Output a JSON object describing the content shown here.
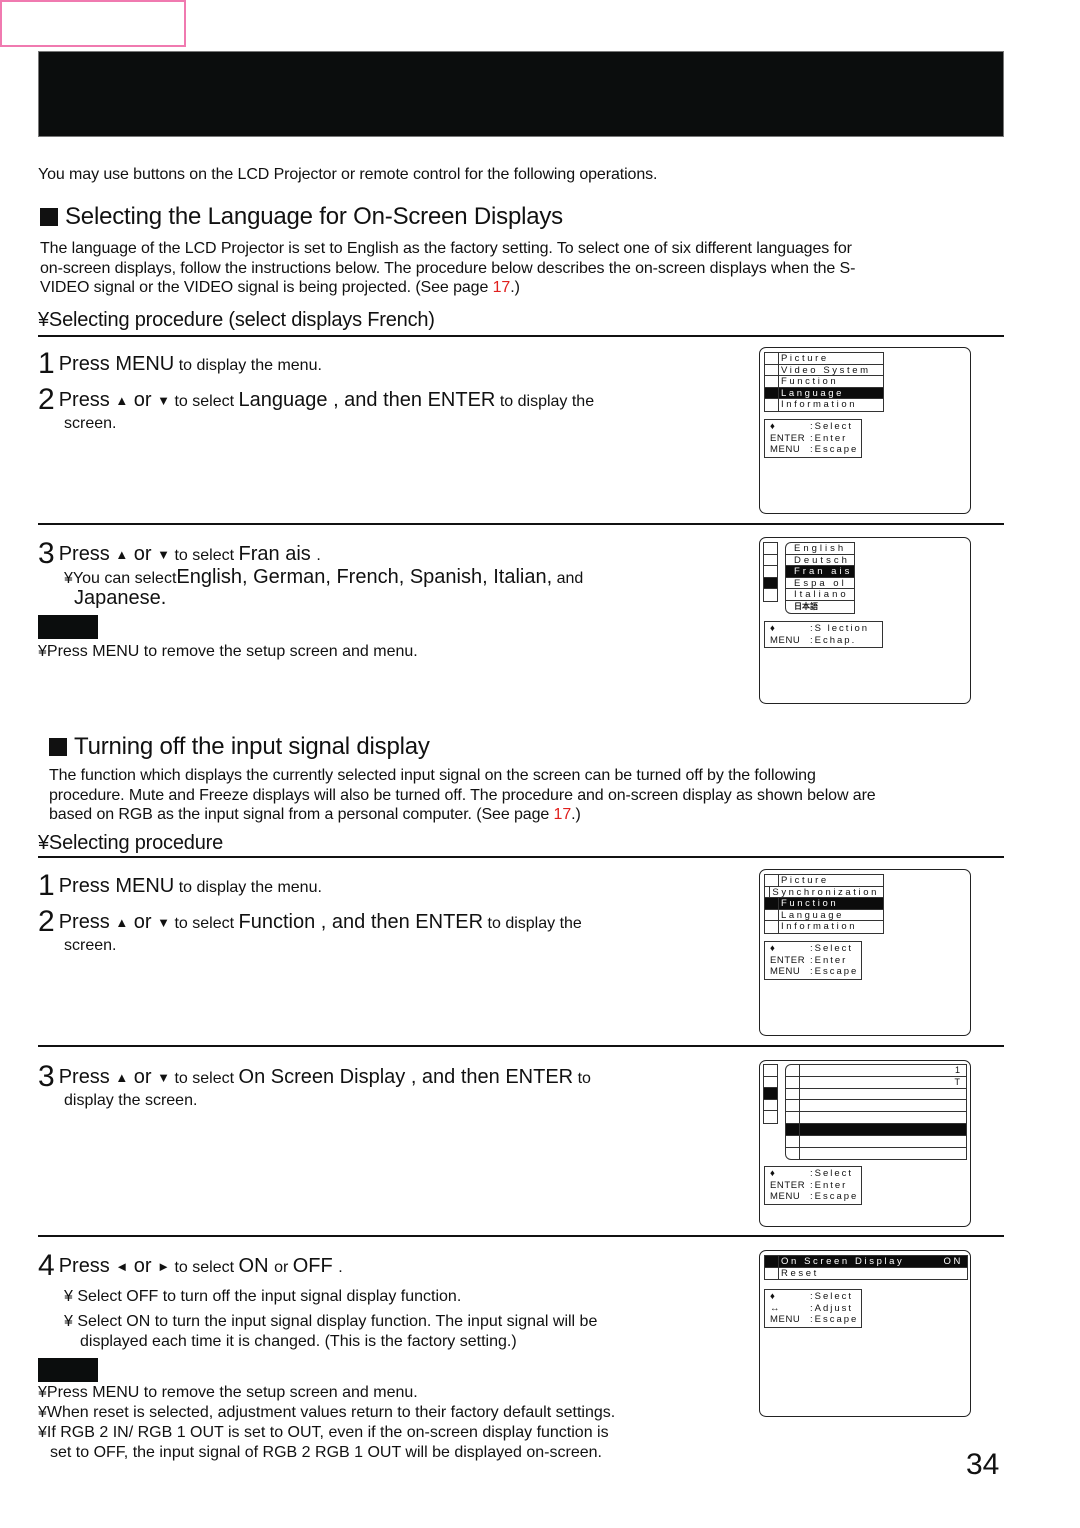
{
  "intro": "You may use buttons on the LCD Projector or remote control for the following operations.",
  "section1": {
    "heading": "Selecting the Language for On-Screen Displays",
    "para_lines": [
      "The language of the LCD Projector is set to English as the factory setting. To select one of six different languages for",
      "on-screen displays, follow the instructions below. The procedure below describes the on-screen displays when the S-",
      "VIDEO signal or the VIDEO signal is being projected. (See page "
    ],
    "para_page_ref": "17",
    "para_end": ".)",
    "subhead": "¥Selecting procedure   (select displays French)",
    "step1": {
      "num": "1",
      "a": "Press MENU",
      "b": " to display the menu."
    },
    "step2": {
      "num": "2",
      "a": "Press ",
      "up": "▲",
      "or": " or ",
      "down": "▼",
      "b": " to select ",
      "c": " Language ",
      "d": ", and then  ENTER",
      "e": " to display the",
      "cont": "screen."
    },
    "step3": {
      "num": "3",
      "a": "Press ",
      "up": "▲",
      "or": " or ",
      "down": "▼",
      "b": " to select ",
      "c": " Fran ais ",
      "d": " ."
    },
    "bullet_a_pre": "¥You can select",
    "bullet_a_big": "English, German, French, Spanish, Italian,",
    "bullet_a_post": " and",
    "bullet_a_cont": "Japanese.",
    "note": "¥Press MENU to remove the setup screen and menu.",
    "osd1": {
      "items": [
        "Picture",
        "Video System",
        "Function",
        "Language",
        "Information"
      ],
      "selected_index": 3,
      "help": [
        {
          "key": "♦",
          "val": ":Select"
        },
        {
          "key": "ENTER",
          "val": ":Enter"
        },
        {
          "key": "MENU",
          "val": ":Escape"
        }
      ]
    },
    "osd2": {
      "sidebar_selected_index": 3,
      "languages": [
        "English",
        "Deutsch",
        "Fran ais",
        "Espa ol",
        "Italiano",
        "日本語"
      ],
      "selected_index": 2,
      "help": [
        {
          "key": "♦",
          "val": ":S lection"
        },
        {
          "key": "MENU",
          "val": ":Echap."
        }
      ]
    }
  },
  "section2": {
    "heading": "Turning off the input signal display",
    "para_lines": [
      "The function which displays the currently selected input signal on the screen can be turned off by the following",
      "procedure. Mute and Freeze displays will also be turned off. The procedure and on-screen display as shown below are",
      "based on RGB as the input signal from a personal computer. (See page "
    ],
    "para_page_ref": "17",
    "para_end": ".)",
    "subhead": "¥Selecting procedure",
    "step1": {
      "num": "1",
      "a": "Press MENU",
      "b": " to display the menu."
    },
    "step2": {
      "num": "2",
      "a": "Press ",
      "up": "▲",
      "or": " or ",
      "down": "▼",
      "b": " to select ",
      "c": " Function ",
      "d": ",  and then ENTER",
      "e": "  to display the",
      "cont": "screen."
    },
    "step3": {
      "num": "3",
      "a": "Press ",
      "up": "▲",
      "or": " or ",
      "down": "▼",
      "b": " to select ",
      "c": " On Screen Display ",
      "d": ",  and then ENTER",
      "e": "  to",
      "cont": "display the screen."
    },
    "step4": {
      "num": "4",
      "a": "Press ",
      "left": "◄",
      "or": " or ",
      "right": "►",
      "b": "  to select ",
      "c": " ON ",
      "d": "  or ",
      "e": " OFF ",
      "f": " ."
    },
    "bullet_off": "¥  Select  OFF  to turn off the input signal display function.",
    "bullet_on": "¥  Select  ON  to turn the input signal display function. The input signal will be",
    "bullet_on_cont": "displayed each time it is changed. (This is the factory setting.)",
    "notes": [
      "¥Press MENU to remove the setup screen and menu.",
      "¥When reset is selected, adjustment values return to their factory default settings.",
      "¥If RGB 2 IN/ RGB 1 OUT is set to OUT, even if the on-screen display function is",
      "set to OFF, the input signal of  RGB 2 RGB 1 OUT  will be displayed on-screen."
    ],
    "osd3": {
      "items": [
        "Picture",
        "Synchronization",
        "Function",
        "Language",
        "Information"
      ],
      "selected_index": 2,
      "help": [
        {
          "key": "♦",
          "val": ":Select"
        },
        {
          "key": "ENTER",
          "val": ":Enter"
        },
        {
          "key": "MENU",
          "val": ":Escape"
        }
      ]
    },
    "osd4": {
      "sidebar_selected_index": 2,
      "rows": [
        "1",
        "T",
        "",
        "",
        "",
        "",
        "",
        ""
      ],
      "selected_index": 5,
      "help": [
        {
          "key": "♦",
          "val": ":Select"
        },
        {
          "key": "ENTER",
          "val": ":Enter"
        },
        {
          "key": "MENU",
          "val": ":Escape"
        }
      ]
    },
    "osd5": {
      "items": [
        {
          "label": "On Screen Display",
          "value": "ON"
        },
        {
          "label": "Reset",
          "value": ""
        }
      ],
      "selected_index": 0,
      "help": [
        {
          "key": "♦",
          "val": ":Select"
        },
        {
          "key": "↔",
          "val": ":Adjust"
        },
        {
          "key": "MENU",
          "val": ":Escape"
        }
      ]
    }
  },
  "page_number": "34"
}
